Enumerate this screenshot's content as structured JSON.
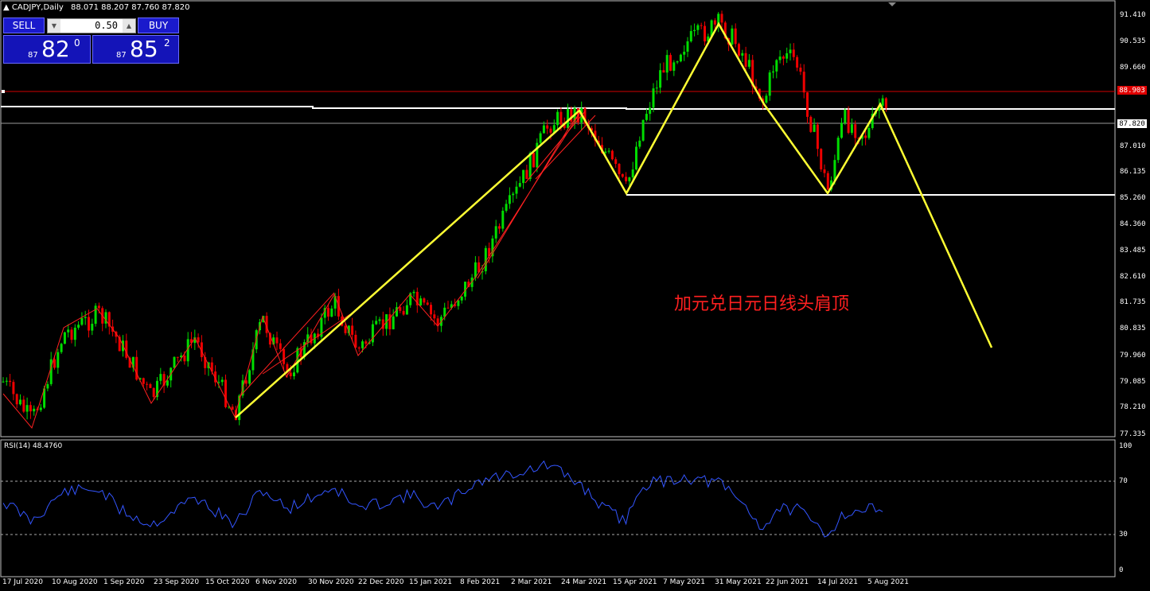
{
  "window": {
    "title": "CADJPY,Daily",
    "ohlc": "88.071 88.207 87.760 87.820"
  },
  "trade_panel": {
    "sell_label": "SELL",
    "buy_label": "BUY",
    "lot_value": "0.50",
    "sell_price": {
      "prefix": "87",
      "big": "82",
      "sup": "0"
    },
    "buy_price": {
      "prefix": "87",
      "big": "85",
      "sup": "2"
    }
  },
  "price_axis": [
    "91.410",
    "90.535",
    "89.660",
    "88.760",
    "87.010",
    "86.135",
    "85.260",
    "84.360",
    "83.485",
    "82.610",
    "81.735",
    "80.835",
    "79.960",
    "79.085",
    "78.210",
    "77.335"
  ],
  "price_tags": {
    "red_line": "88.903",
    "current": "87.820"
  },
  "time_axis": [
    "17 Jul 2020",
    "10 Aug 2020",
    "1 Sep 2020",
    "23 Sep 2020",
    "15 Oct 2020",
    "6 Nov 2020",
    "30 Nov 2020",
    "22 Dec 2020",
    "15 Jan 2021",
    "8 Feb 2021",
    "2 Mar 2021",
    "24 Mar 2021",
    "15 Apr 2021",
    "7 May 2021",
    "31 May 2021",
    "22 Jun 2021",
    "14 Jul 2021",
    "5 Aug 2021"
  ],
  "annotation": "加元兑日元日线头肩顶",
  "rsi": {
    "label": "RSI(14) 48.4760",
    "levels": [
      "100",
      "70",
      "30",
      "0"
    ]
  },
  "colors": {
    "bull": "#00dd00",
    "bear": "#ee0000",
    "pattern": "#ffff33",
    "rsi_line": "#3355ff",
    "background": "#000000"
  },
  "icons": {
    "scroll_marker": "triangle-down-icon",
    "lot_down": "arrow-down-icon",
    "lot_up": "arrow-up-icon"
  }
}
